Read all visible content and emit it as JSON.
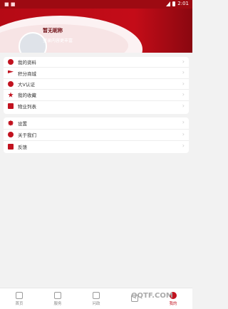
{
  "status_bar": {
    "time": "2:01"
  },
  "header": {
    "title": "暂无昵称",
    "subtitle": "登录内容更丰富"
  },
  "menu_group_1": [
    {
      "label": "我的资料",
      "icon": "circle-user-icon"
    },
    {
      "label": "积分商城",
      "icon": "flag-icon"
    },
    {
      "label": "大V认证",
      "icon": "badge-icon"
    },
    {
      "label": "我的收藏",
      "icon": "star-icon"
    },
    {
      "label": "物业列表",
      "icon": "list-icon"
    }
  ],
  "menu_group_2": [
    {
      "label": "设置",
      "icon": "gear-icon"
    },
    {
      "label": "关于我们",
      "icon": "info-icon"
    },
    {
      "label": "反馈",
      "icon": "edit-icon"
    }
  ],
  "tabs": [
    {
      "label": "首页"
    },
    {
      "label": "服务"
    },
    {
      "label": "问政"
    },
    {
      "label": ""
    },
    {
      "label": "我的"
    }
  ],
  "watermark": "QQTF.COM",
  "colors": {
    "accent": "#c1121f",
    "header_dark": "#9d0a12"
  }
}
